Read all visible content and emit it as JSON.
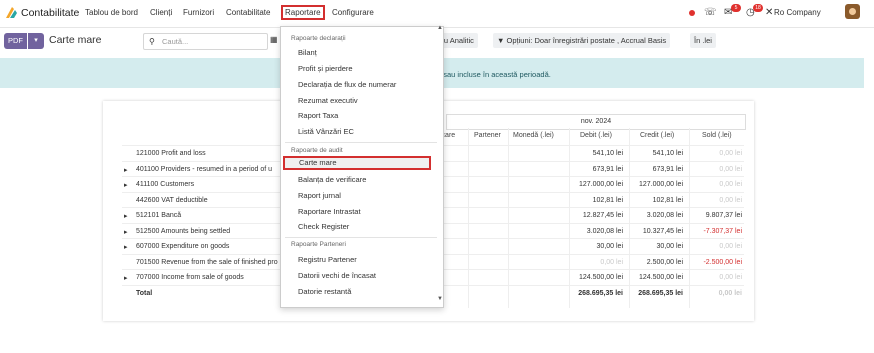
{
  "navbar": {
    "app_name": "Contabilitate",
    "menus": [
      "Tablou de bord",
      "Clienți",
      "Furnizori",
      "Contabilitate",
      "Raportare",
      "Configurare"
    ],
    "active_menu": "Raportare",
    "badge_chat": "5",
    "badge_activity": "18",
    "company": "Ro Company",
    "icons": [
      "app-icon",
      "status-dot",
      "phone-icon",
      "chat-icon",
      "activity-icon",
      "tools-icon",
      "avatar"
    ]
  },
  "control": {
    "pdf_label": "PDF",
    "title": "Carte mare",
    "search_placeholder": "Caută...",
    "filter_analytic": "iltru Analitic",
    "filter_options": "Opțiuni: Doar înregistrări postate , Accrual Basis",
    "filter_currency": "În .lei"
  },
  "banner": {
    "text": "e sau incluse în această perioadă."
  },
  "report": {
    "period": "nov. 2024",
    "columns": [
      "icare",
      "Partener",
      "Monedă (.lei)",
      "Debit (.lei)",
      "Credit (.lei)",
      "Sold (.lei)"
    ],
    "rows": [
      {
        "label": "121000 Profit and loss",
        "arrow": "",
        "debit": "541,10 lei",
        "credit": "541,10 lei",
        "sold": "0,00 lei",
        "sold_style": "muted"
      },
      {
        "label": "401100 Providers - resumed in a period of u",
        "arrow": "▸",
        "debit": "673,91 lei",
        "credit": "673,91 lei",
        "sold": "0,00 lei",
        "sold_style": "muted"
      },
      {
        "label": "411100 Customers",
        "arrow": "▸",
        "debit": "127.000,00 lei",
        "credit": "127.000,00 lei",
        "sold": "0,00 lei",
        "sold_style": "muted"
      },
      {
        "label": "442600 VAT deductible",
        "arrow": "",
        "debit": "102,81 lei",
        "credit": "102,81 lei",
        "sold": "0,00 lei",
        "sold_style": "muted"
      },
      {
        "label": "512101 Bancă",
        "arrow": "▸",
        "debit": "12.827,45 lei",
        "credit": "3.020,08 lei",
        "sold": "9.807,37 lei",
        "sold_style": ""
      },
      {
        "label": "512500 Amounts being settled",
        "arrow": "▸",
        "debit": "3.020,08 lei",
        "credit": "10.327,45 lei",
        "sold": "-7.307,37 lei",
        "sold_style": "neg"
      },
      {
        "label": "607000 Expenditure on goods",
        "arrow": "▸",
        "debit": "30,00 lei",
        "credit": "30,00 lei",
        "sold": "0,00 lei",
        "sold_style": "muted"
      },
      {
        "label": "701500 Revenue from the sale of finished pro",
        "arrow": "",
        "debit": "0,00 lei",
        "credit": "2.500,00 lei",
        "sold": "-2.500,00 lei",
        "sold_style": "neg",
        "debit_style": "muted"
      },
      {
        "label": "707000 Income from sale of goods",
        "arrow": "▸",
        "debit": "124.500,00 lei",
        "credit": "124.500,00 lei",
        "sold": "0,00 lei",
        "sold_style": "muted"
      }
    ],
    "total": {
      "label": "Total",
      "debit": "268.695,35 lei",
      "credit": "268.695,35 lei",
      "sold": "0,00 lei"
    }
  },
  "dropdown": {
    "section_declarations": "Rapoarte declarații",
    "declarations": [
      "Bilanț",
      "Profit și pierdere",
      "Declarația de flux de numerar",
      "Rezumat executiv",
      "Raport Taxa",
      "Listă Vânzări EC"
    ],
    "section_audit": "Rapoarte de audit",
    "audit": [
      "Carte mare",
      "Balanța de verificare",
      "Raport jurnal",
      "Raportare Intrastat",
      "Check Register"
    ],
    "selected": "Carte mare",
    "section_partners": "Rapoarte Parteneri",
    "partners": [
      "Registru Partener",
      "Datorii vechi de încasat",
      "Datorie restantă"
    ]
  },
  "colors": {
    "accent": "#71639e",
    "highlight_border": "#d32f2f",
    "banner": "#d4ecee"
  }
}
